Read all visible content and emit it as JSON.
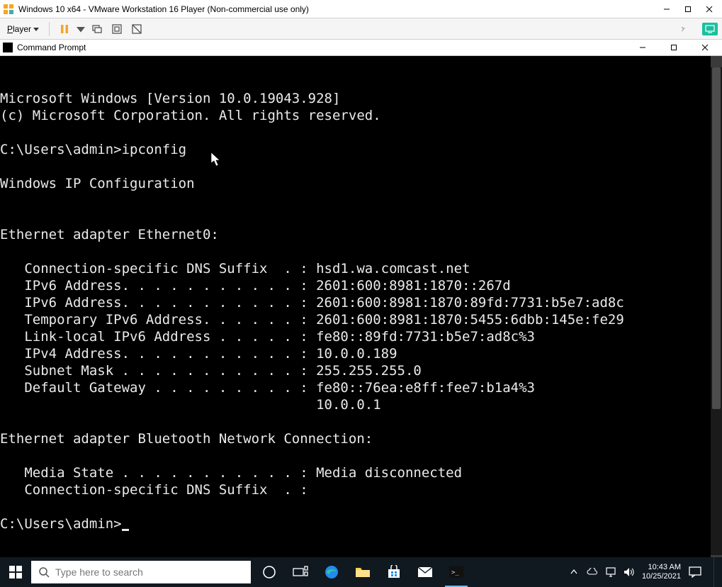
{
  "vmware": {
    "title": "Windows 10 x64 - VMware Workstation 16 Player (Non-commercial use only)",
    "player_menu_label": "Player"
  },
  "cmd": {
    "title": "Command Prompt",
    "lines": [
      "Microsoft Windows [Version 10.0.19043.928]",
      "(c) Microsoft Corporation. All rights reserved.",
      "",
      "C:\\Users\\admin>ipconfig",
      "",
      "Windows IP Configuration",
      "",
      "",
      "Ethernet adapter Ethernet0:",
      "",
      "   Connection-specific DNS Suffix  . : hsd1.wa.comcast.net",
      "   IPv6 Address. . . . . . . . . . . : 2601:600:8981:1870::267d",
      "   IPv6 Address. . . . . . . . . . . : 2601:600:8981:1870:89fd:7731:b5e7:ad8c",
      "   Temporary IPv6 Address. . . . . . : 2601:600:8981:1870:5455:6dbb:145e:fe29",
      "   Link-local IPv6 Address . . . . . : fe80::89fd:7731:b5e7:ad8c%3",
      "   IPv4 Address. . . . . . . . . . . : 10.0.0.189",
      "   Subnet Mask . . . . . . . . . . . : 255.255.255.0",
      "   Default Gateway . . . . . . . . . : fe80::76ea:e8ff:fee7:b1a4%3",
      "                                       10.0.0.1",
      "",
      "Ethernet adapter Bluetooth Network Connection:",
      "",
      "   Media State . . . . . . . . . . . : Media disconnected",
      "   Connection-specific DNS Suffix  . :",
      ""
    ],
    "prompt": "C:\\Users\\admin>"
  },
  "taskbar": {
    "search_placeholder": "Type here to search",
    "time": "10:43 AM",
    "date": "10/25/2021"
  }
}
